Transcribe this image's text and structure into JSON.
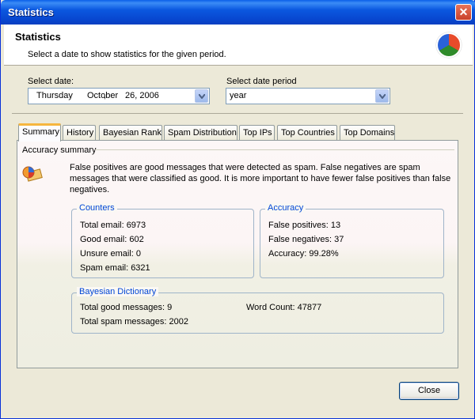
{
  "window": {
    "title": "Statistics"
  },
  "header": {
    "title": "Statistics",
    "subtitle": "Select a date to show statistics for the given period."
  },
  "date": {
    "label": "Select date:",
    "weekday": "Thursday",
    "sep": ",",
    "month": "October",
    "day_year": "26, 2006"
  },
  "period": {
    "label": "Select date period",
    "value": "year"
  },
  "tabs": [
    "Summary",
    "History",
    "Bayesian Rank",
    "Spam Distribution",
    "Top IPs",
    "Top Countries",
    "Top Domains"
  ],
  "summary": {
    "section_title": "Accuracy summary",
    "description": "False positives are good messages that were detected as spam. False negatives are spam messages that were classified as good. It is more important to have fewer false positives than false negatives.",
    "counters": {
      "title": "Counters",
      "total": "Total email: 6973",
      "good": "Good email: 602",
      "unsure": "Unsure email: 0",
      "spam": "Spam email: 6321"
    },
    "accuracy": {
      "title": "Accuracy",
      "false_positives": "False positives: 13",
      "false_negatives": "False negatives: 37",
      "accuracy": "Accuracy: 99.28%"
    },
    "bayesian": {
      "title": "Bayesian Dictionary",
      "good": "Total good messages: 9",
      "spam": "Total spam messages: 2002",
      "word_count": "Word Count: 47877"
    }
  },
  "buttons": {
    "close": "Close"
  },
  "colors": {
    "titlebar": "#0a4fd8",
    "group_title": "#0046d5",
    "active_tab_accent": "#f6b63e"
  }
}
